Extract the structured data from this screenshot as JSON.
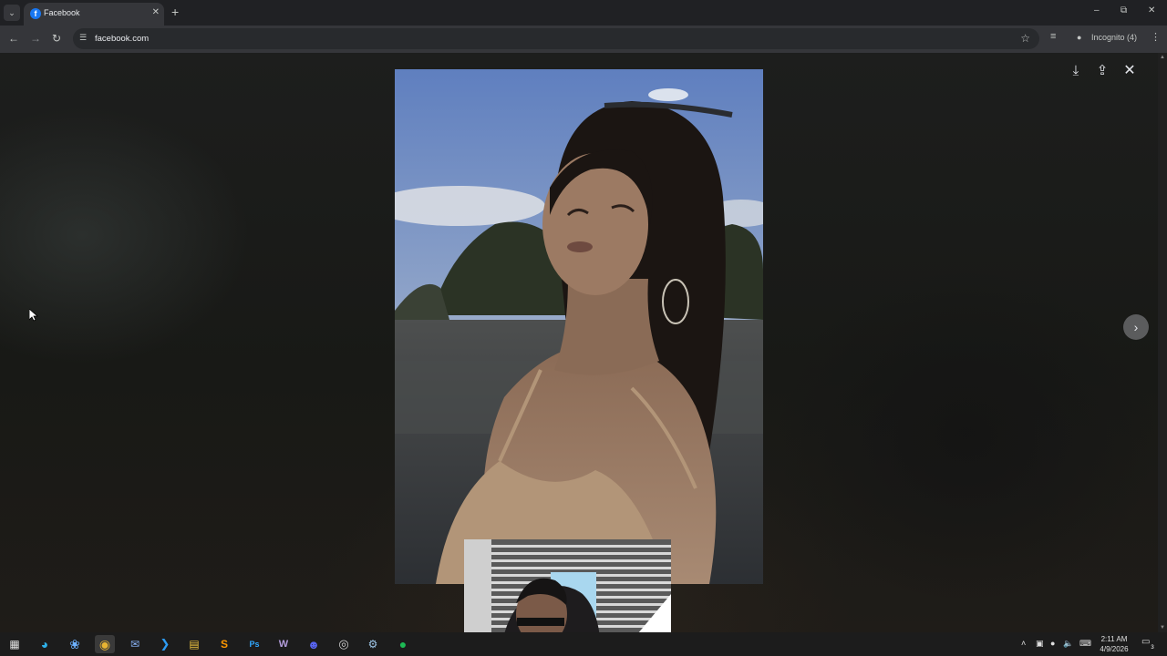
{
  "browser": {
    "tab": {
      "title": "Facebook",
      "favicon": "f"
    },
    "url": "facebook.com",
    "incognito_label": "Incognito (4)",
    "accent": "#1877f2"
  },
  "viewer": {
    "actions": [
      "download-icon",
      "share-icon",
      "close-icon"
    ],
    "next": "chevron-right-icon"
  },
  "taskbar": {
    "apps": [
      "start",
      "edge",
      "copilot",
      "chrome",
      "mail",
      "vscode",
      "file-explorer",
      "sublime",
      "photoshop",
      "twitch",
      "discord",
      "obs",
      "steam",
      "spotify"
    ],
    "photoshop_label": "Ps",
    "clock": {
      "time": "2:11 AM",
      "date": "4/9/2026"
    },
    "notifications": "3"
  }
}
